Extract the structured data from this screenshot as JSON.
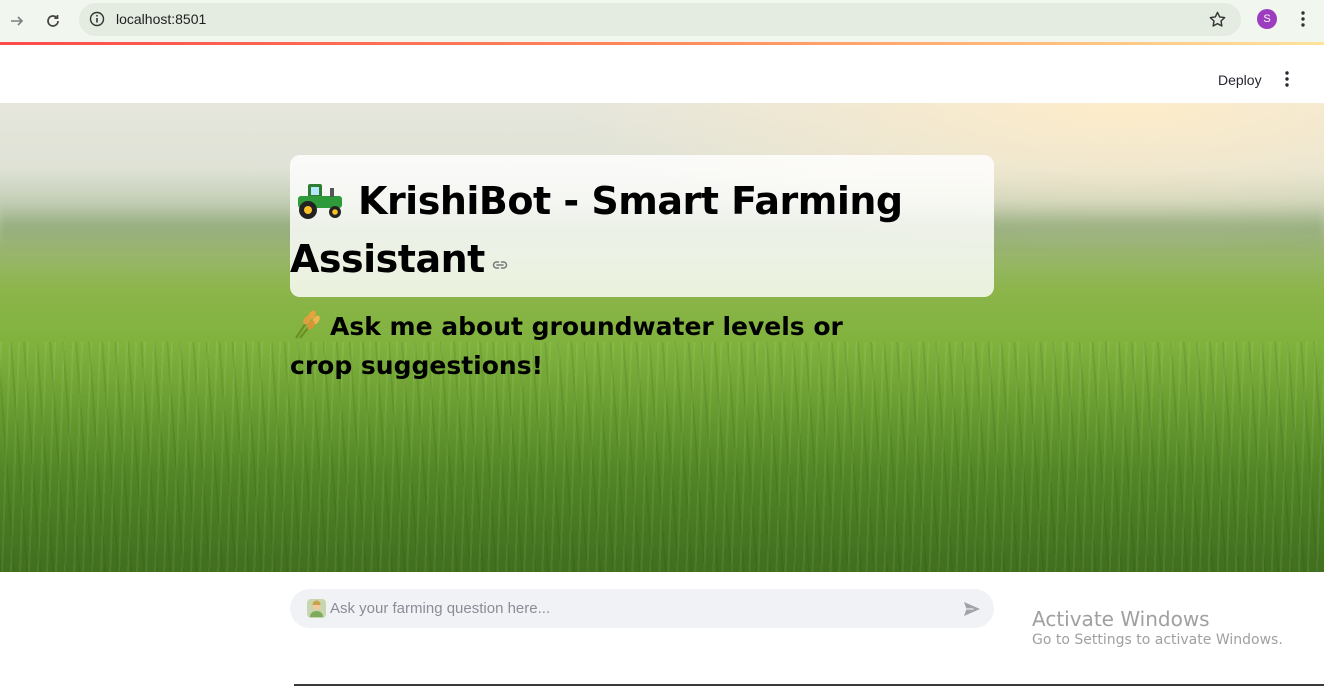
{
  "browser": {
    "url": "localhost:8501",
    "profile_initial": "S",
    "icons": [
      "forward-icon",
      "reload-icon",
      "site-info-icon",
      "bookmark-star-icon",
      "browser-menu-icon"
    ]
  },
  "app_header": {
    "deploy_label": "Deploy"
  },
  "hero": {
    "title": "KrishiBot - Smart Farming Assistant",
    "subtitle": "Ask me about groundwater levels or crop suggestions!"
  },
  "chat": {
    "placeholder": "Ask your farming question here..."
  },
  "os_watermark": {
    "title": "Activate Windows",
    "subtitle": "Go to Settings to activate Windows."
  },
  "colors": {
    "accent": "#ff4b4b",
    "profile": "#9c3dbf",
    "input_bg": "#f0f2f6"
  }
}
